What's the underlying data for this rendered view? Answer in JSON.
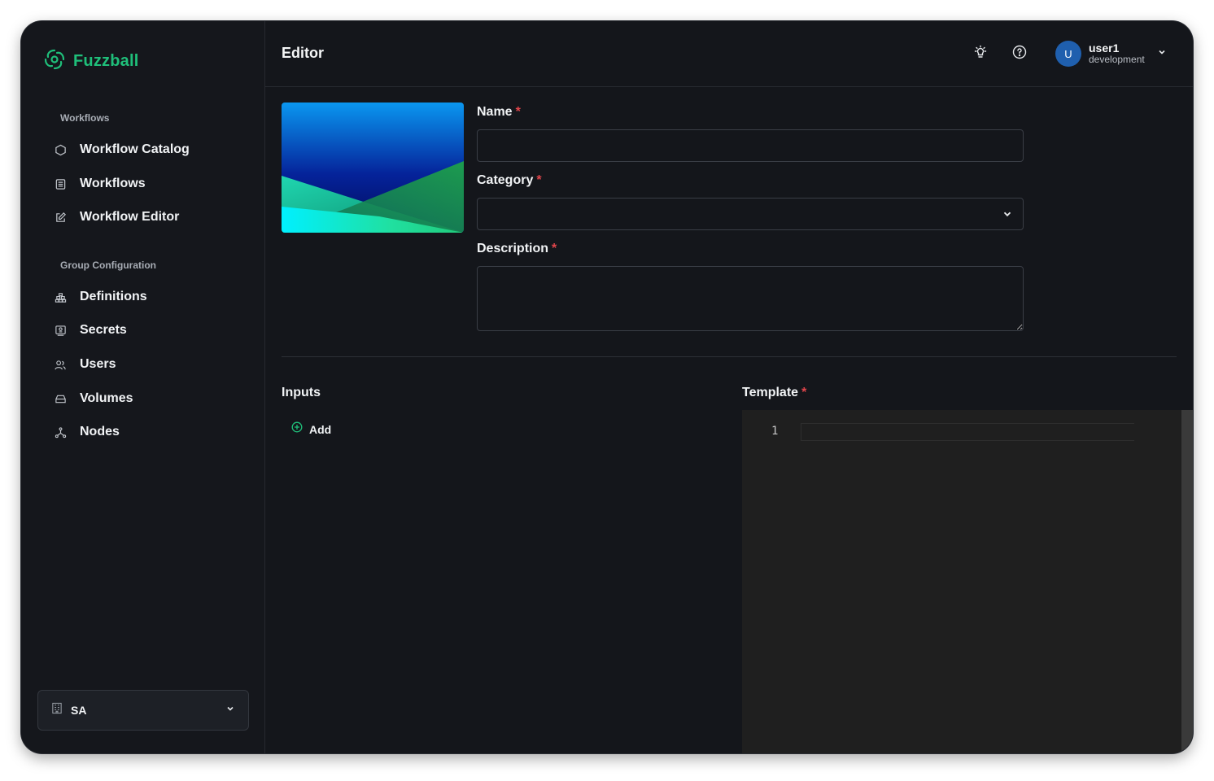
{
  "app": {
    "name": "Fuzzball",
    "brand_color": "#1fbf7a"
  },
  "sidebar": {
    "sections": [
      {
        "title": "Workflows",
        "items": [
          {
            "label": "Workflow Catalog",
            "icon": "hexagon-icon"
          },
          {
            "label": "Workflows",
            "icon": "list-icon"
          },
          {
            "label": "Workflow Editor",
            "icon": "edit-icon"
          }
        ]
      },
      {
        "title": "Group Configuration",
        "items": [
          {
            "label": "Definitions",
            "icon": "stack-icon"
          },
          {
            "label": "Secrets",
            "icon": "key-icon"
          },
          {
            "label": "Users",
            "icon": "users-icon"
          },
          {
            "label": "Volumes",
            "icon": "drive-icon"
          },
          {
            "label": "Nodes",
            "icon": "nodes-icon"
          }
        ]
      }
    ],
    "org_selector": {
      "label": "SA",
      "icon": "building-icon"
    }
  },
  "header": {
    "title": "Editor",
    "theme_icon": "lightbulb-icon",
    "help_icon": "help-circle-icon",
    "user": {
      "avatar_initial": "U",
      "name": "user1",
      "environment": "development"
    }
  },
  "form": {
    "name": {
      "label": "Name",
      "required": "*",
      "value": ""
    },
    "category": {
      "label": "Category",
      "required": "*",
      "value": ""
    },
    "description": {
      "label": "Description",
      "required": "*",
      "value": ""
    }
  },
  "inputs": {
    "title": "Inputs",
    "add_label": "Add"
  },
  "template": {
    "title": "Template",
    "required": "*",
    "line_number": "1"
  },
  "colors": {
    "background": "#14161b",
    "required": "#e0454b",
    "avatar": "#1f5fae",
    "editor": "#1f1f1f"
  }
}
